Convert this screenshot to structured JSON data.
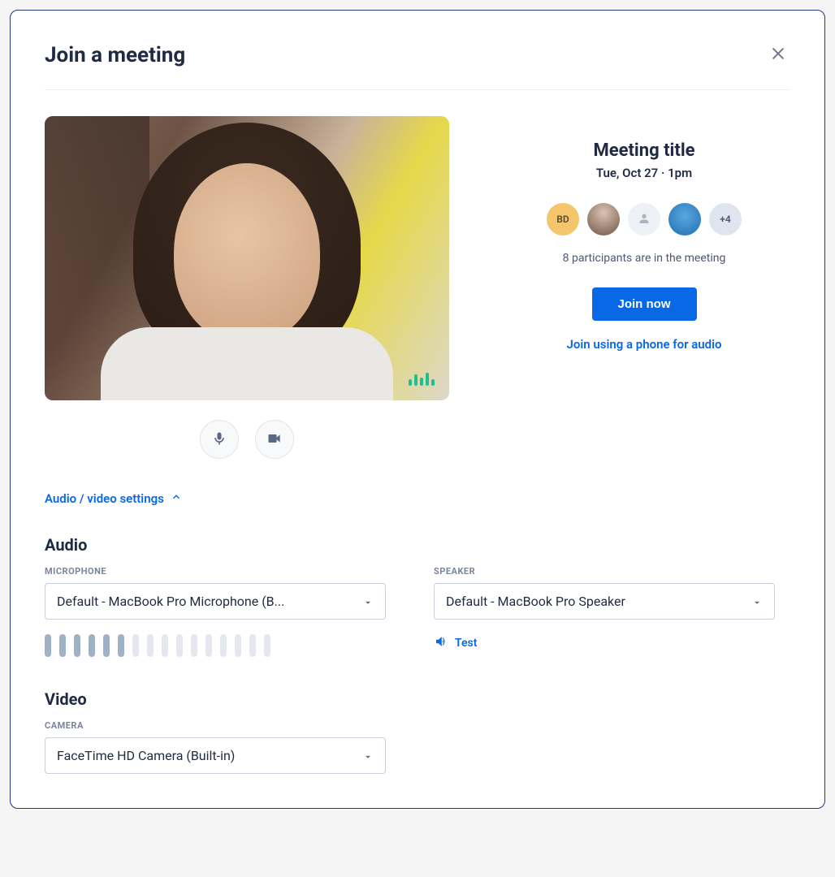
{
  "modal": {
    "title": "Join a meeting"
  },
  "meeting": {
    "title": "Meeting title",
    "time": "Tue, Oct 27 · 1pm",
    "avatars": {
      "initials": "BD",
      "overflow": "+4"
    },
    "participants_text": "8 participants are in the meeting",
    "join_label": "Join now",
    "phone_label": "Join using a phone for audio"
  },
  "settings_toggle": "Audio / video settings",
  "audio": {
    "section_title": "Audio",
    "microphone_label": "MICROPHONE",
    "microphone_value": "Default - MacBook Pro Microphone (B...",
    "speaker_label": "SPEAKER",
    "speaker_value": "Default - MacBook Pro Speaker",
    "test_label": "Test",
    "mic_level_active": 6,
    "mic_level_total": 16
  },
  "video": {
    "section_title": "Video",
    "camera_label": "CAMERA",
    "camera_value": "FaceTime HD Camera (Built-in)"
  }
}
